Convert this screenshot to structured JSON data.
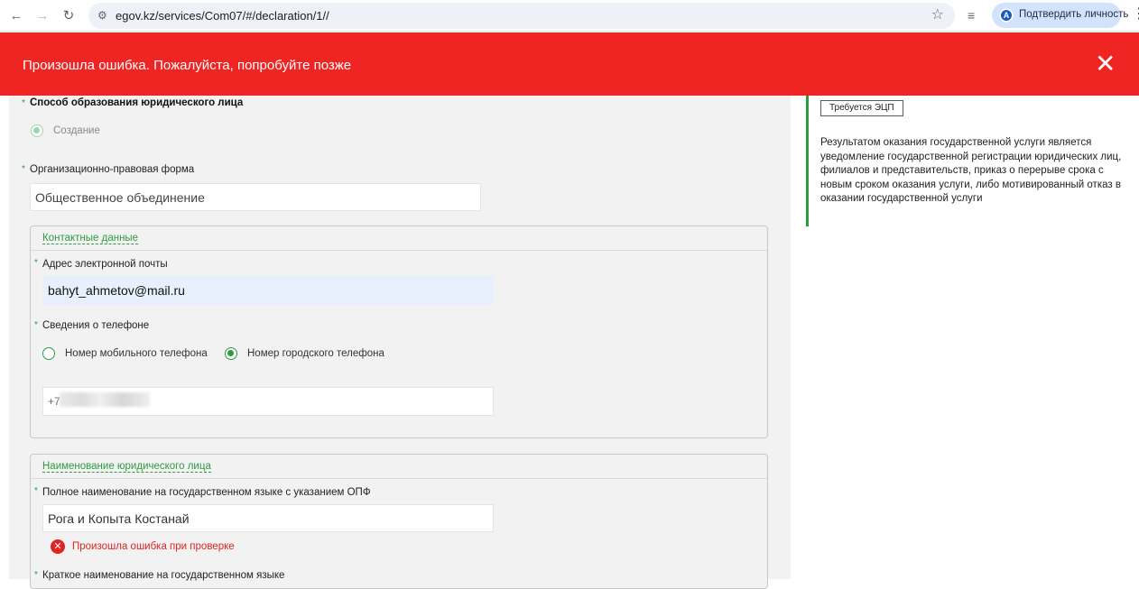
{
  "browser": {
    "back_icon": "←",
    "forward_icon": "→",
    "reload_icon": "↻",
    "site_settings_icon": "⚙",
    "url": "egov.kz/services/Com07/#/declaration/1//",
    "bookmark_icon": "☆",
    "reading_list_icon": "≡",
    "identity_label": "Подтвердить личность",
    "avatar_letter": "A",
    "menu_icon": "⋮"
  },
  "error_banner": {
    "message": "Произошла ошибка. Пожалуйста, попробуйте позже",
    "close_icon": "✕",
    "color": "#ee2522"
  },
  "form": {
    "formation_method": {
      "label": "Способ образования юридического лица",
      "option": "Создание"
    },
    "legal_form": {
      "label": "Организационно-правовая форма",
      "value": "Общественное объединение"
    },
    "contacts": {
      "legend": "Контактные данные",
      "email_label": "Адрес электронной почты",
      "email_value": "bahyt_ahmetov@mail.ru",
      "phone_label": "Сведения о телефоне",
      "phone_options": [
        "Номер мобильного телефона",
        "Номер городского телефона"
      ],
      "phone_prefix": "+7"
    },
    "entity_name": {
      "legend": "Наименование юридического лица",
      "full_name_label": "Полное наименование на государственном языке с указанием ОПФ",
      "full_name_value": "Рога и Копыта Костанай",
      "error_icon": "✕",
      "error_message": "Произошла ошибка при проверке",
      "short_name_label": "Краткое наименование на государственном языке"
    },
    "required_mark": "*"
  },
  "info_panel": {
    "badge": "Требуется ЭЦП",
    "text": "Результатом оказания государственной услуги является уведомление государственной регистрации юридических лиц, филиалов и представительств, приказ о перерыве срока с новым сроком оказания услуги, либо мотивированный отказ в оказании государственной услуги",
    "accent_color": "#2e9a41"
  }
}
